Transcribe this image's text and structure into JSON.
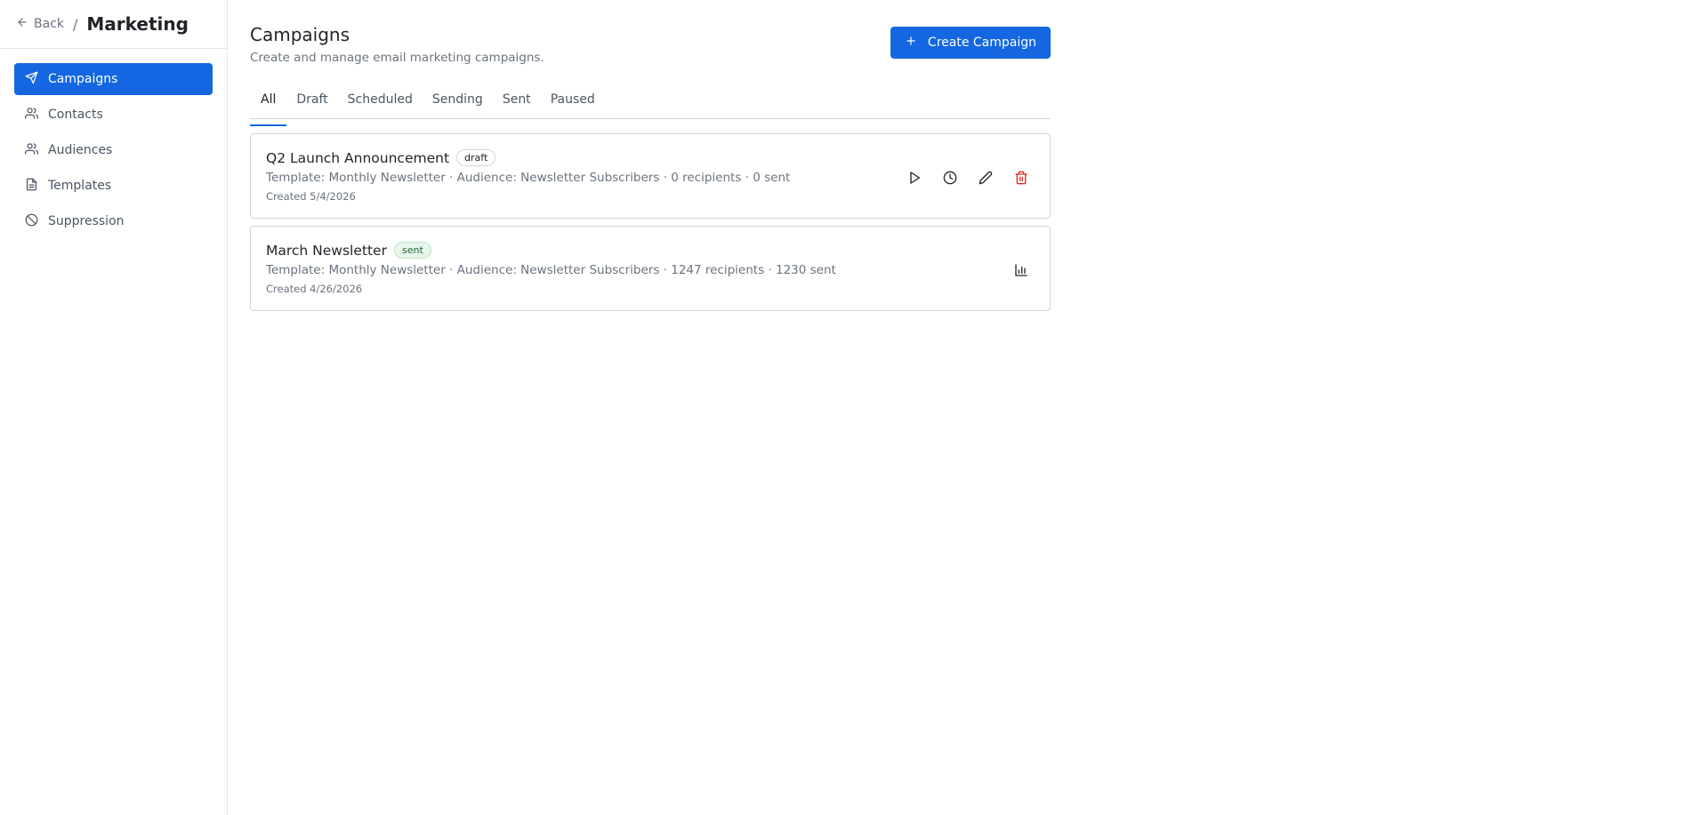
{
  "sidebar": {
    "back_label": "Back",
    "separator": "/",
    "app_title": "Marketing",
    "items": [
      {
        "label": "Campaigns",
        "icon": "send-icon",
        "active": true
      },
      {
        "label": "Contacts",
        "icon": "users-icon",
        "active": false
      },
      {
        "label": "Audiences",
        "icon": "users-icon",
        "active": false
      },
      {
        "label": "Templates",
        "icon": "file-text-icon",
        "active": false
      },
      {
        "label": "Suppression",
        "icon": "ban-icon",
        "active": false
      }
    ]
  },
  "header": {
    "title": "Campaigns",
    "subtitle": "Create and manage email marketing campaigns.",
    "create_label": "Create Campaign"
  },
  "tabs": [
    {
      "label": "All",
      "active": true
    },
    {
      "label": "Draft",
      "active": false
    },
    {
      "label": "Scheduled",
      "active": false
    },
    {
      "label": "Sending",
      "active": false
    },
    {
      "label": "Sent",
      "active": false
    },
    {
      "label": "Paused",
      "active": false
    }
  ],
  "campaigns": [
    {
      "name": "Q2 Launch Announcement",
      "status": "draft",
      "meta": "Template: Monthly Newsletter · Audience: Newsletter Subscribers · 0 recipients · 0 sent",
      "created": "Created 5/4/2026",
      "actions": [
        "play-icon",
        "clock-icon",
        "pencil-icon",
        "trash-icon"
      ]
    },
    {
      "name": "March Newsletter",
      "status": "sent",
      "meta": "Template: Monthly Newsletter · Audience: Newsletter Subscribers · 1247 recipients · 1230 sent",
      "created": "Created 4/26/2026",
      "actions": [
        "bar-chart-icon"
      ]
    }
  ],
  "colors": {
    "accent": "#1467e0",
    "danger": "#dc2626",
    "sent_badge_bg": "#e6f6ea"
  }
}
